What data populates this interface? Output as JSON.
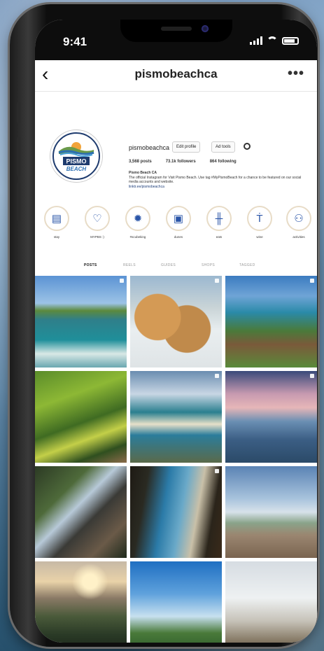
{
  "status_bar": {
    "time": "9:41"
  },
  "nav": {
    "back_icon": "chevron-left-icon",
    "username": "pismobeachca",
    "more_icon": "more-dots-icon",
    "more_glyph": "•••"
  },
  "profile": {
    "avatar_text_top": "PISMO",
    "avatar_text_bottom": "BEACH",
    "handle": "pismobeachca",
    "edit_profile_label": "Edit profile",
    "ad_tools_label": "Ad tools",
    "settings_icon": "gear-icon",
    "stats": {
      "posts": "3,568 posts",
      "followers": "73.1k followers",
      "following": "864 following"
    },
    "bio": {
      "name": "Pismo Beach CA",
      "text": "The official Instagram for Visit Pismo Beach. Use tag #MyPismoBeach for a chance to be featured on our social media accounts and website.",
      "link": "linktr.ee/pismobeachca"
    }
  },
  "highlights": [
    {
      "label": "stay",
      "icon": "hotel-icon",
      "glyph": "▤"
    },
    {
      "label": "MYPBS :)",
      "icon": "heart-icon",
      "glyph": "♡"
    },
    {
      "label": "#scubeking",
      "icon": "sun-icon",
      "glyph": "✹"
    },
    {
      "label": "dunes",
      "icon": "car-icon",
      "glyph": "▣"
    },
    {
      "label": "eats",
      "icon": "utensils-icon",
      "glyph": "╫"
    },
    {
      "label": "wine",
      "icon": "wine-icon",
      "glyph": "Ṫ"
    },
    {
      "label": "activities",
      "icon": "activity-icon",
      "glyph": "⚇"
    }
  ],
  "tabs": [
    {
      "label": "POSTS",
      "active": true
    },
    {
      "label": "REELS",
      "active": false
    },
    {
      "label": "GUIDES",
      "active": false
    },
    {
      "label": "SHOPS",
      "active": false
    },
    {
      "label": "TAGGED",
      "active": false
    }
  ],
  "posts": [
    {
      "label": "coastline-waves"
    },
    {
      "label": "clam-chowder-bread-bowl"
    },
    {
      "label": "cliffside-town"
    },
    {
      "label": "green-hills"
    },
    {
      "label": "aerial-beach"
    },
    {
      "label": "pier-sunset"
    },
    {
      "label": "cliff-stairs"
    },
    {
      "label": "palm-trees-coast"
    },
    {
      "label": "cloudy-beach"
    },
    {
      "label": "sunset-cliffs"
    },
    {
      "label": "palm-promenade"
    },
    {
      "label": "beach-walkers"
    }
  ],
  "colors": {
    "accent": "#2a55a8",
    "ring": "#e8dcc7",
    "frame": "#0e0e0e"
  }
}
